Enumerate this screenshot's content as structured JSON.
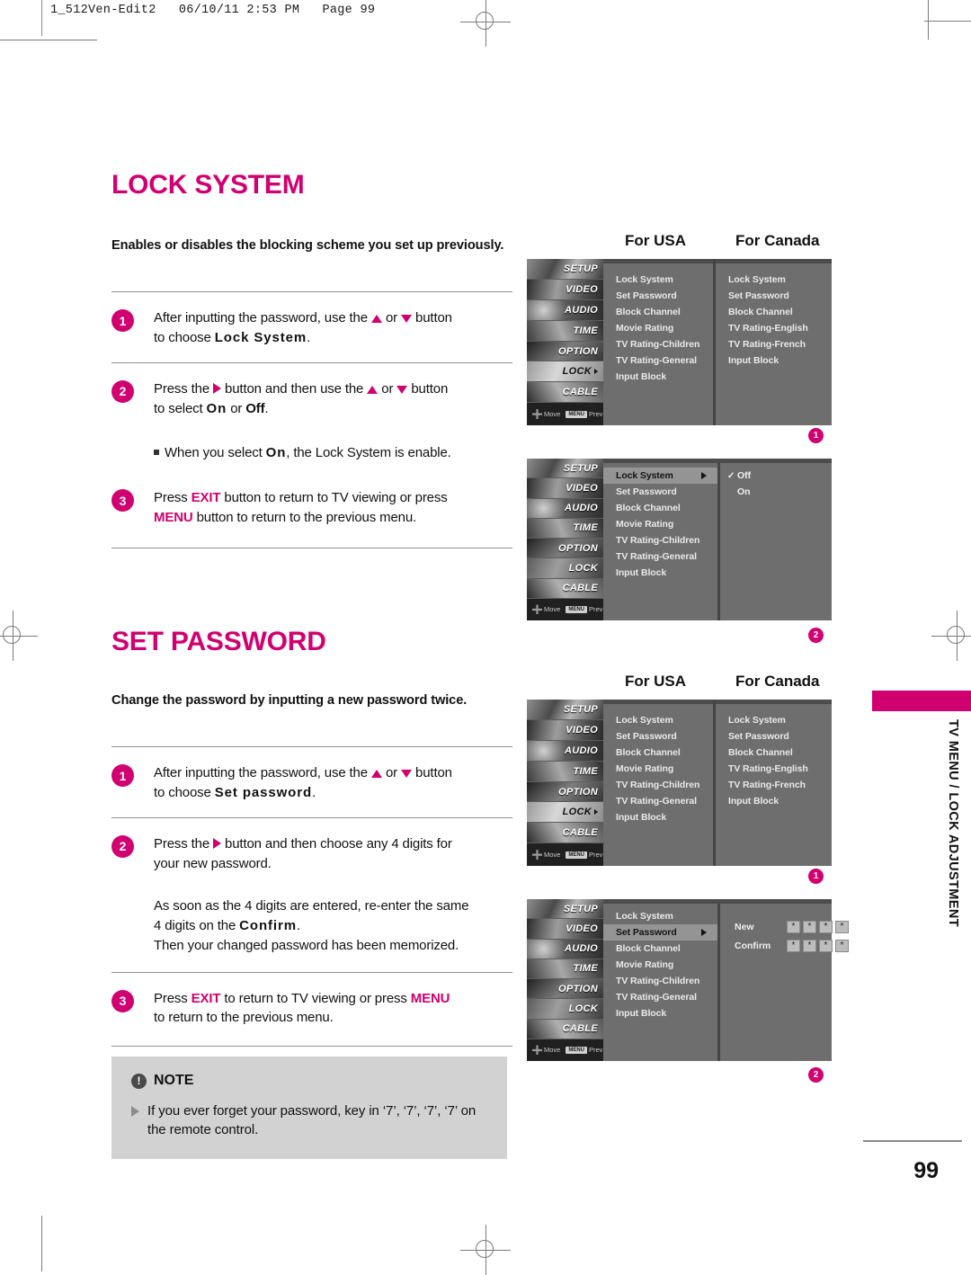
{
  "header": {
    "file_line": "1_512Ven-Edit2   06/10/11 2:53 PM   Page 99"
  },
  "sections": [
    {
      "title": "LOCK SYSTEM",
      "lead": "Enables or disables the blocking scheme you set up previously.",
      "steps": [
        {
          "num": "1",
          "line1_a": "After inputting the password, use the ",
          "line1_b": " or ",
          "line1_c": " button",
          "line2_a": "to choose ",
          "line2_bold": "Lock System",
          "line2_c": "."
        },
        {
          "num": "2",
          "line1_a": "Press the ",
          "line1_b": " button and then use the ",
          "line1_c": " or ",
          "line1_d": " button",
          "line2_a": "to select ",
          "line2_bold1": "On",
          "line2_mid": " or ",
          "line2_bold2": "Off",
          "line2_c": "."
        },
        {
          "num": "3",
          "line1_a": "Press ",
          "line1_key": "EXIT",
          "line1_b": " button to return to TV viewing or press",
          "line2_key": "MENU",
          "line2_b": " button to return to the previous menu."
        }
      ],
      "bullet": {
        "a": "When you select ",
        "bold": "On",
        "b": ", the Lock System is enable."
      }
    },
    {
      "title": "SET PASSWORD",
      "lead": "Change the password by inputting a new password twice.",
      "steps": [
        {
          "num": "1",
          "line1_a": "After inputting the password, use the ",
          "line1_b": " or ",
          "line1_c": " button",
          "line2_a": "to choose ",
          "line2_bold": "Set password",
          "line2_c": "."
        },
        {
          "num": "2",
          "line1_a": "Press the ",
          "line1_b": " button and then choose any 4 digits for",
          "line2": "your new password."
        },
        {
          "num": "3",
          "line1_a": "Press ",
          "line1_key": "EXIT",
          "line1_b": " to return to TV viewing or press ",
          "line1_key2": "MENU",
          "line2": "to return to the previous menu."
        }
      ],
      "extra": {
        "line1": "As soon as the 4 digits are entered, re-enter the same",
        "line2_a": "4 digits on the ",
        "line2_bold": "Confirm",
        "line2_c": ".",
        "line3": "Then your changed password has been memorized."
      }
    }
  ],
  "note": {
    "icon": "!",
    "title": "NOTE",
    "items": [
      "If you ever forget your password, key in ‘7’, ‘7’, ‘7’, ‘7’ on the remote control."
    ]
  },
  "osd": {
    "region_labels": {
      "usa": "For USA",
      "canada": "For Canada"
    },
    "sidebar": [
      {
        "label": "SETUP",
        "active": false
      },
      {
        "label": "VIDEO",
        "active": false
      },
      {
        "label": "AUDIO",
        "active": false
      },
      {
        "label": "TIME",
        "active": false
      },
      {
        "label": "OPTION",
        "active": false
      },
      {
        "label": "LOCK",
        "active": true
      },
      {
        "label": "CABLE",
        "active": false
      }
    ],
    "hints": {
      "move": "Move",
      "prev": "Prev",
      "menu_key": "MENU"
    },
    "usa_menu": [
      "Lock System",
      "Set Password",
      "Block Channel",
      "Movie Rating",
      "TV Rating-Children",
      "TV Rating-General",
      "Input Block"
    ],
    "canada_menu": [
      "Lock System",
      "Set Password",
      "Block Channel",
      "TV Rating-English",
      "TV Rating-French",
      "Input Block"
    ],
    "lock_system_options": [
      {
        "label": "Off",
        "checked": true
      },
      {
        "label": "On",
        "checked": false
      }
    ],
    "password_fields": [
      {
        "label": "New",
        "digits": [
          "*",
          "*",
          "*",
          "*"
        ]
      },
      {
        "label": "Confirm",
        "digits": [
          "*",
          "*",
          "*",
          "*"
        ]
      }
    ],
    "callouts": {
      "one": "1",
      "two": "2"
    }
  },
  "side_tab": {
    "text": "TV MENU / LOCK ADJUSTMENT"
  },
  "footer": {
    "page_number": "99"
  },
  "colors": {
    "accent": "#D10070",
    "note_bg": "#d2d2d2",
    "osd_bg": "#6e6e6e"
  }
}
